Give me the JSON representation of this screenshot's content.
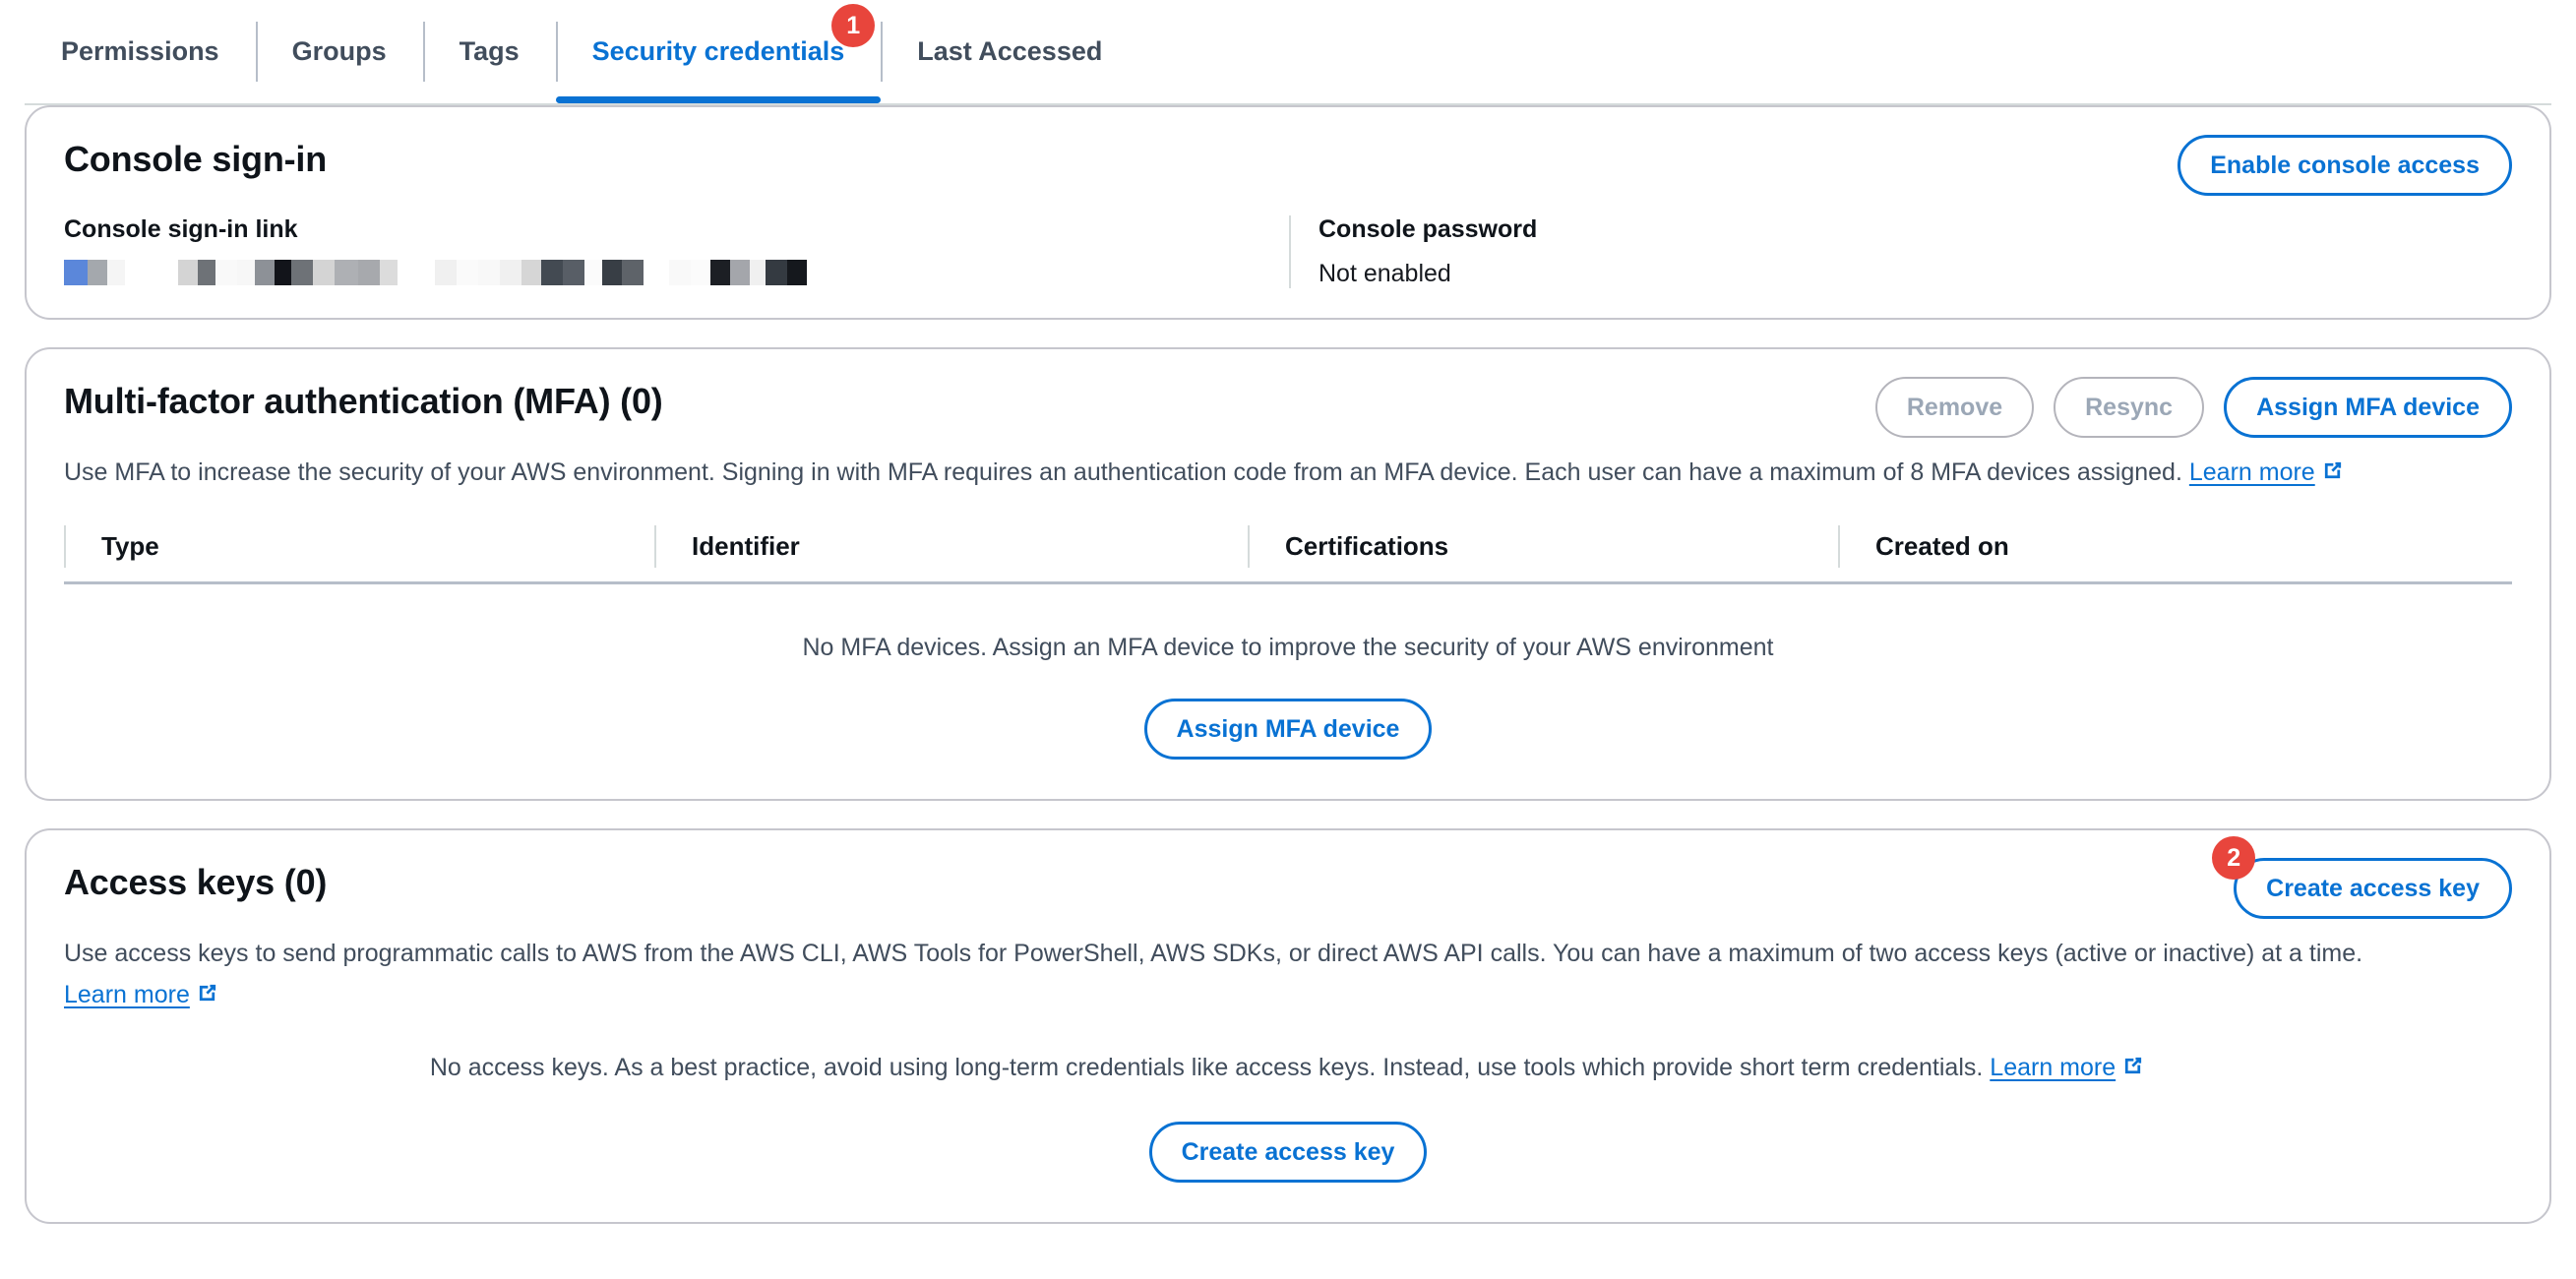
{
  "tabs": [
    {
      "label": "Permissions",
      "active": false,
      "badge": null
    },
    {
      "label": "Groups",
      "active": false,
      "badge": null
    },
    {
      "label": "Tags",
      "active": false,
      "badge": null
    },
    {
      "label": "Security credentials",
      "active": true,
      "badge": "1"
    },
    {
      "label": "Last Accessed",
      "active": false,
      "badge": null
    }
  ],
  "console_signin": {
    "title": "Console sign-in",
    "enable_button": "Enable console access",
    "signin_link_label": "Console sign-in link",
    "signin_link_value": "",
    "password_label": "Console password",
    "password_value": "Not enabled"
  },
  "mfa": {
    "title": "Multi-factor authentication (MFA) (0)",
    "remove_button": "Remove",
    "resync_button": "Resync",
    "assign_button": "Assign MFA device",
    "description": "Use MFA to increase the security of your AWS environment. Signing in with MFA requires an authentication code from an MFA device. Each user can have a maximum of 8 MFA devices assigned.",
    "learn_more": "Learn more",
    "columns": [
      "Type",
      "Identifier",
      "Certifications",
      "Created on"
    ],
    "rows": [],
    "empty_text": "No MFA devices. Assign an MFA device to improve the security of your AWS environment",
    "empty_button": "Assign MFA device"
  },
  "access_keys": {
    "title": "Access keys (0)",
    "create_button": "Create access key",
    "create_button_badge": "2",
    "description": "Use access keys to send programmatic calls to AWS from the AWS CLI, AWS Tools for PowerShell, AWS SDKs, or direct AWS API calls. You can have a maximum of two access keys (active or inactive) at a time.",
    "learn_more": "Learn more",
    "empty_text": "No access keys. As a best practice, avoid using long-term credentials like access keys. Instead, use tools which provide short term credentials.",
    "empty_learn_more": "Learn more",
    "empty_button": "Create access key"
  },
  "colors": {
    "link": "#0972d3",
    "badge": "#e8453c",
    "border": "#c6c6cd",
    "text": "#16191f",
    "muted": "#414d5c"
  },
  "icons": {
    "external_link": "external-link-icon"
  }
}
